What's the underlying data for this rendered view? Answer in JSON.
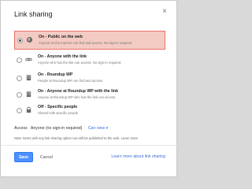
{
  "dialog": {
    "title": "Link sharing",
    "close_glyph": "×"
  },
  "options": [
    {
      "title_bold": "On - Public on the web",
      "title_rest": "",
      "description": "Anyone on the Internet can find and access. No sign-in required.",
      "icon": "globe-icon",
      "selected": true
    },
    {
      "title_bold": "On - Anyone with the link",
      "title_rest": "",
      "description": "Anyone who has the link can access. No sign-in required.",
      "icon": "link-icon",
      "selected": false
    },
    {
      "title_bold": "On - Roundup WP",
      "title_rest": "",
      "description": "People at Roundup WP can find and access.",
      "icon": "building-icon",
      "selected": false
    },
    {
      "title_bold": "On - Anyone at Roundup WP with the link",
      "title_rest": "",
      "description": "Anyone at Roundup WP who has the link can access.",
      "icon": "building-icon",
      "selected": false
    },
    {
      "title_bold": "Off - Specific people",
      "title_rest": "",
      "description": "Shared with specific people",
      "icon": "lock-icon",
      "selected": false
    }
  ],
  "access": {
    "label": "Access",
    "value": "Anyone (no sign-in required)",
    "link": "Can view ▾"
  },
  "note": "Note: Items with any link sharing option can still be published to the web. Learn more",
  "buttons": {
    "save": "Save",
    "cancel": "Cancel"
  },
  "learn_more": "Learn more about link sharing",
  "colors": {
    "selected_bg": "#f4cbc3",
    "selected_border": "#e8736a",
    "primary": "#4d90fe",
    "link": "#3b6fd0"
  }
}
